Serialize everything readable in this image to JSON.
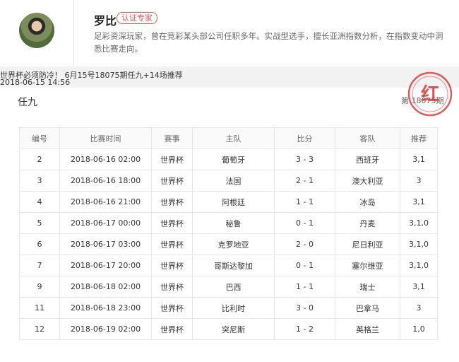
{
  "expert": {
    "name": "罗比",
    "badge": "认证专家",
    "bio": "足彩资深玩家，曾在竞彩某头部公司任职多年。实战型选手，擅长亚洲指数分析，在指数变动中洞悉比赛走向。"
  },
  "article": {
    "headline": "世界杯必须防冷！ 6月15号18075期任九+14场推荐",
    "datetime": "2018-06-15 14:56"
  },
  "card": {
    "title": "任九",
    "period": "第 18075期",
    "stamp": "红"
  },
  "table": {
    "headers": [
      "编号",
      "比赛时间",
      "赛事",
      "主队",
      "比分",
      "客队",
      "推荐"
    ],
    "rows": [
      [
        "2",
        "2018-06-16 02:00",
        "世界杯",
        "葡萄牙",
        "3 - 3",
        "西班牙",
        "3,1"
      ],
      [
        "3",
        "2018-06-16 18:00",
        "世界杯",
        "法国",
        "2 - 1",
        "澳大利亚",
        "3"
      ],
      [
        "4",
        "2018-06-16 21:00",
        "世界杯",
        "阿根廷",
        "1 - 1",
        "冰岛",
        "3,1"
      ],
      [
        "5",
        "2018-06-17 00:00",
        "世界杯",
        "秘鲁",
        "0 - 1",
        "丹麦",
        "3,1,0"
      ],
      [
        "6",
        "2018-06-17 03:00",
        "世界杯",
        "克罗地亚",
        "2 - 0",
        "尼日利亚",
        "3,1,0"
      ],
      [
        "7",
        "2018-06-17 20:00",
        "世界杯",
        "哥斯达黎加",
        "0 - 1",
        "塞尔维亚",
        "3,1,0"
      ],
      [
        "9",
        "2018-06-18 02:00",
        "世界杯",
        "巴西",
        "1 - 1",
        "瑞士",
        "3,1"
      ],
      [
        "11",
        "2018-06-18 23:00",
        "世界杯",
        "比利时",
        "3 - 0",
        "巴拿马",
        "3"
      ],
      [
        "12",
        "2018-06-19 02:00",
        "世界杯",
        "突尼斯",
        "1 - 2",
        "英格兰",
        "1,0"
      ]
    ]
  },
  "colors": {
    "accent_red": "#e05a5a",
    "border": "#e6e6e6"
  }
}
